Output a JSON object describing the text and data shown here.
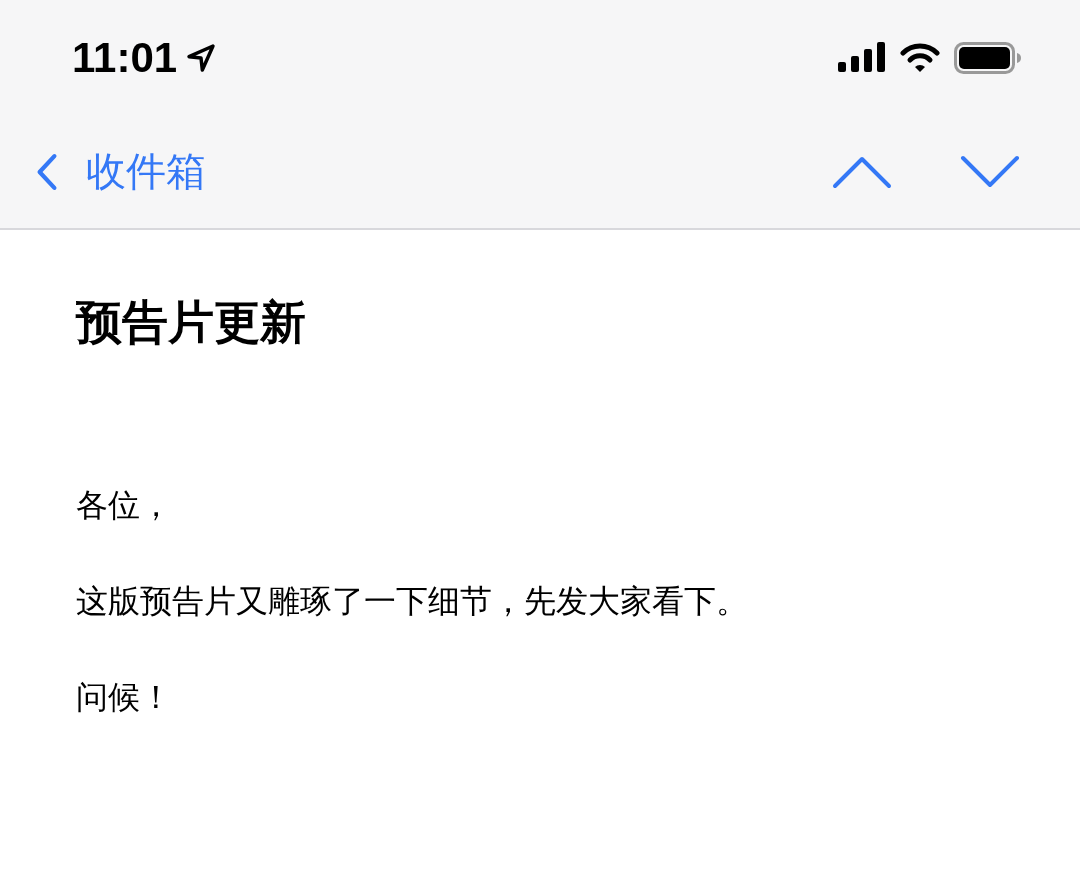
{
  "status_bar": {
    "time": "11:01"
  },
  "nav_bar": {
    "back_label": "收件箱"
  },
  "message": {
    "subject": "预告片更新",
    "body": [
      "各位，",
      "这版预告片又雕琢了一下细节，先发大家看下。",
      "问候！"
    ]
  }
}
